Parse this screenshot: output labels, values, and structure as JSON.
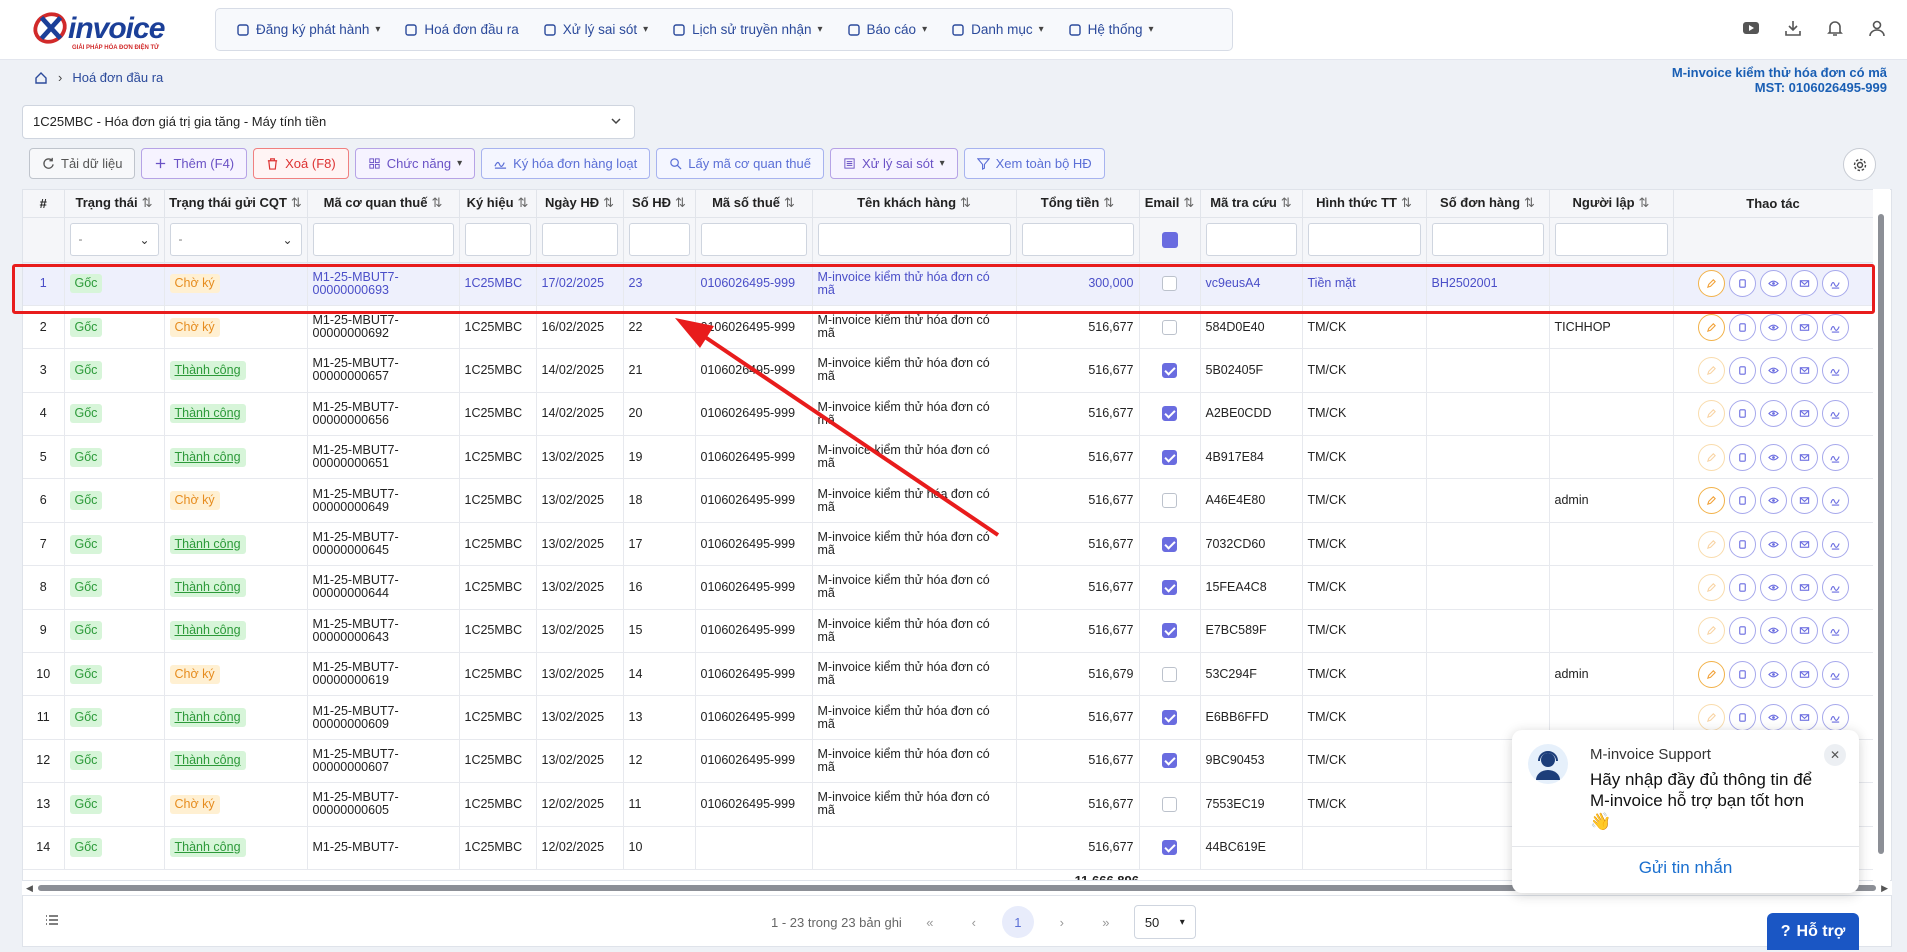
{
  "brand": {
    "logo_text": "invoice",
    "logo_sub": "GIẢI PHÁP HÓA ĐƠN ĐIỆN TỬ"
  },
  "menu": [
    {
      "label": "Đăng ký phát hành",
      "icon": "register-icon",
      "dropdown": true
    },
    {
      "label": "Hoá đơn đầu ra",
      "icon": "document-icon",
      "dropdown": false
    },
    {
      "label": "Xử lý sai sót",
      "icon": "fix-icon",
      "dropdown": true
    },
    {
      "label": "Lịch sử truyền nhận",
      "icon": "transfer-icon",
      "dropdown": true
    },
    {
      "label": "Báo cáo",
      "icon": "report-icon",
      "dropdown": true
    },
    {
      "label": "Danh mục",
      "icon": "catalog-icon",
      "dropdown": true
    },
    {
      "label": "Hệ thống",
      "icon": "system-gear-icon",
      "dropdown": true
    }
  ],
  "breadcrumb": {
    "current": "Hoá đơn đầu ra"
  },
  "company": {
    "name": "M-invoice kiểm thử hóa đơn có mã",
    "tax": "MST: 0106026495-999"
  },
  "series": {
    "value": "1C25MBC - Hóa đơn giá trị gia tăng - Máy tính tiền"
  },
  "toolbar": {
    "reload": "Tải dữ liệu",
    "add": "Thêm (F4)",
    "delete": "Xoá (F8)",
    "functions": "Chức năng",
    "batch_sign": "Ký hóa đơn hàng loạt",
    "get_code": "Lấy mã cơ quan thuế",
    "fix": "Xử lý sai sót",
    "view_all": "Xem toàn bộ HĐ"
  },
  "columns": [
    "#",
    "Trạng thái",
    "Trạng thái gửi CQT",
    "Mã cơ quan thuế",
    "Ký hiệu",
    "Ngày HĐ",
    "Số HĐ",
    "Mã số thuế",
    "Tên khách hàng",
    "Tổng tiền",
    "Email",
    "Mã tra cứu",
    "Hình thức TT",
    "Số đơn hàng",
    "Người lập",
    "Thao tác"
  ],
  "filter_placeholder": "-",
  "rows": [
    {
      "no": "1",
      "status": "Gốc",
      "cqt": "Chờ ký",
      "code": "M1-25-MBUT7-00000000693",
      "sym": "1C25MBC",
      "date": "17/02/2025",
      "num": "23",
      "tax": "0106026495-999",
      "customer": "M-invoice kiểm thử hóa đơn có mã",
      "total": "300,000",
      "email": false,
      "lookup": "vc9eusA4",
      "pay": "Tiền mặt",
      "order": "BH2502001",
      "creator": "",
      "selected": true
    },
    {
      "no": "2",
      "status": "Gốc",
      "cqt": "Chờ ký",
      "code": "M1-25-MBUT7-00000000692",
      "sym": "1C25MBC",
      "date": "16/02/2025",
      "num": "22",
      "tax": "0106026495-999",
      "customer": "M-invoice kiểm thử hóa đơn có mã",
      "total": "516,677",
      "email": false,
      "lookup": "584D0E40",
      "pay": "TM/CK",
      "order": "",
      "creator": "TICHHOP"
    },
    {
      "no": "3",
      "status": "Gốc",
      "cqt": "Thành công",
      "code": "M1-25-MBUT7-00000000657",
      "sym": "1C25MBC",
      "date": "14/02/2025",
      "num": "21",
      "tax": "0106026495-999",
      "customer": "M-invoice kiểm thử hóa đơn có mã",
      "total": "516,677",
      "email": true,
      "lookup": "5B02405F",
      "pay": "TM/CK",
      "order": "",
      "creator": ""
    },
    {
      "no": "4",
      "status": "Gốc",
      "cqt": "Thành công",
      "code": "M1-25-MBUT7-00000000656",
      "sym": "1C25MBC",
      "date": "14/02/2025",
      "num": "20",
      "tax": "0106026495-999",
      "customer": "M-invoice kiểm thử hóa đơn có mã",
      "total": "516,677",
      "email": true,
      "lookup": "A2BE0CDD",
      "pay": "TM/CK",
      "order": "",
      "creator": ""
    },
    {
      "no": "5",
      "status": "Gốc",
      "cqt": "Thành công",
      "code": "M1-25-MBUT7-00000000651",
      "sym": "1C25MBC",
      "date": "13/02/2025",
      "num": "19",
      "tax": "0106026495-999",
      "customer": "M-invoice kiểm thử hóa đơn có mã",
      "total": "516,677",
      "email": true,
      "lookup": "4B917E84",
      "pay": "TM/CK",
      "order": "",
      "creator": ""
    },
    {
      "no": "6",
      "status": "Gốc",
      "cqt": "Chờ ký",
      "code": "M1-25-MBUT7-00000000649",
      "sym": "1C25MBC",
      "date": "13/02/2025",
      "num": "18",
      "tax": "0106026495-999",
      "customer": "M-invoice kiểm thử hóa đơn có mã",
      "total": "516,677",
      "email": false,
      "lookup": "A46E4E80",
      "pay": "TM/CK",
      "order": "",
      "creator": "admin"
    },
    {
      "no": "7",
      "status": "Gốc",
      "cqt": "Thành công",
      "code": "M1-25-MBUT7-00000000645",
      "sym": "1C25MBC",
      "date": "13/02/2025",
      "num": "17",
      "tax": "0106026495-999",
      "customer": "M-invoice kiểm thử hóa đơn có mã",
      "total": "516,677",
      "email": true,
      "lookup": "7032CD60",
      "pay": "TM/CK",
      "order": "",
      "creator": ""
    },
    {
      "no": "8",
      "status": "Gốc",
      "cqt": "Thành công",
      "code": "M1-25-MBUT7-00000000644",
      "sym": "1C25MBC",
      "date": "13/02/2025",
      "num": "16",
      "tax": "0106026495-999",
      "customer": "M-invoice kiểm thử hóa đơn có mã",
      "total": "516,677",
      "email": true,
      "lookup": "15FEA4C8",
      "pay": "TM/CK",
      "order": "",
      "creator": ""
    },
    {
      "no": "9",
      "status": "Gốc",
      "cqt": "Thành công",
      "code": "M1-25-MBUT7-00000000643",
      "sym": "1C25MBC",
      "date": "13/02/2025",
      "num": "15",
      "tax": "0106026495-999",
      "customer": "M-invoice kiểm thử hóa đơn có mã",
      "total": "516,677",
      "email": true,
      "lookup": "E7BC589F",
      "pay": "TM/CK",
      "order": "",
      "creator": ""
    },
    {
      "no": "10",
      "status": "Gốc",
      "cqt": "Chờ ký",
      "code": "M1-25-MBUT7-00000000619",
      "sym": "1C25MBC",
      "date": "13/02/2025",
      "num": "14",
      "tax": "0106026495-999",
      "customer": "M-invoice kiểm thử hóa đơn có mã",
      "total": "516,679",
      "email": false,
      "lookup": "53C294F",
      "pay": "TM/CK",
      "order": "",
      "creator": "admin"
    },
    {
      "no": "11",
      "status": "Gốc",
      "cqt": "Thành công",
      "code": "M1-25-MBUT7-00000000609",
      "sym": "1C25MBC",
      "date": "13/02/2025",
      "num": "13",
      "tax": "0106026495-999",
      "customer": "M-invoice kiểm thử hóa đơn có mã",
      "total": "516,677",
      "email": true,
      "lookup": "E6BB6FFD",
      "pay": "TM/CK",
      "order": "",
      "creator": ""
    },
    {
      "no": "12",
      "status": "Gốc",
      "cqt": "Thành công",
      "code": "M1-25-MBUT7-00000000607",
      "sym": "1C25MBC",
      "date": "13/02/2025",
      "num": "12",
      "tax": "0106026495-999",
      "customer": "M-invoice kiểm thử hóa đơn có mã",
      "total": "516,677",
      "email": true,
      "lookup": "9BC90453",
      "pay": "TM/CK",
      "order": "",
      "creator": ""
    },
    {
      "no": "13",
      "status": "Gốc",
      "cqt": "Chờ ký",
      "code": "M1-25-MBUT7-00000000605",
      "sym": "1C25MBC",
      "date": "12/02/2025",
      "num": "11",
      "tax": "0106026495-999",
      "customer": "M-invoice kiểm thử hóa đơn có mã",
      "total": "516,677",
      "email": false,
      "lookup": "7553EC19",
      "pay": "TM/CK",
      "order": "",
      "creator": ""
    },
    {
      "no": "14",
      "status": "Gốc",
      "cqt": "Thành công",
      "code": "M1-25-MBUT7-",
      "sym": "1C25MBC",
      "date": "12/02/2025",
      "num": "10",
      "tax": "",
      "customer": "",
      "total": "516,677",
      "email": true,
      "lookup": "44BC619E",
      "pay": "",
      "order": "",
      "creator": ""
    }
  ],
  "grand_total": "11,666,896",
  "pager": {
    "info": "1 - 23 trong 23 bản ghi",
    "current": "1",
    "page_size": "50"
  },
  "chat": {
    "title": "M-invoice Support",
    "message": "Hãy nhập đầy đủ thông tin để M-invoice hỗ trợ bạn tốt hơn 👋",
    "send": "Gửi tin nhắn"
  },
  "support": {
    "label": "Hỗ trợ"
  },
  "colors": {
    "accent": "#6a6ce0",
    "brand": "#1b3f98",
    "annotation": "#e81c1c"
  }
}
